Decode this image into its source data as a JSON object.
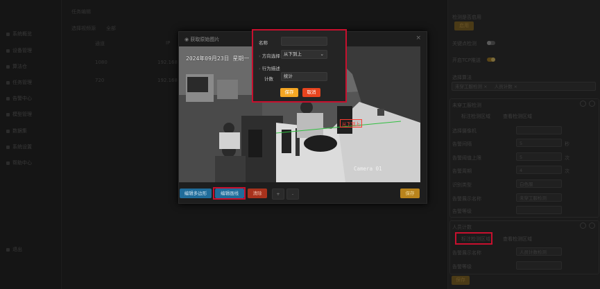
{
  "sidebar": {
    "items": [
      "系统概览",
      "设备管理",
      "算法仓",
      "任务管理",
      "告警中心",
      "模型管理",
      "数据集",
      "系统设置",
      "帮助中心",
      "退出"
    ]
  },
  "background": {
    "header": "任务编辑",
    "filter_text": "选择视频源",
    "filter_value": "全部",
    "col_a": "通道",
    "col_b": "IP",
    "row1": "1080",
    "row1_ip": "192.168",
    "row2": "720",
    "row2_ip": "192.168"
  },
  "right_panel": {
    "rule_enable_label": "检测是否启用",
    "rule_enable_btn": "启用",
    "toggle1_label": "关键点检测",
    "toggle2_label": "开启TCP推送",
    "algo_select_label": "选择算法",
    "algo_tags": [
      "未穿工服检测 ×",
      "人员计数 ×"
    ],
    "section1": {
      "title": "未穿工服检测",
      "tab1": "标注检测区域",
      "tab2": "查看检测区域",
      "fields": [
        {
          "label": "选择摄像机",
          "value": ""
        },
        {
          "label": "告警间隔",
          "value": "5",
          "unit": "秒"
        },
        {
          "label": "告警阈值上限",
          "value": "5",
          "unit": "次"
        },
        {
          "label": "告警周期",
          "value": "4",
          "unit": "次"
        },
        {
          "label": "识别类型",
          "value": "白色服"
        },
        {
          "label": "告警展示名称",
          "value": "未穿工服检测"
        },
        {
          "label": "告警等级",
          "value": ""
        }
      ]
    },
    "section2": {
      "title": "人员计数",
      "tab1": "标注检测区域",
      "tab2": "查看检测区域",
      "fields": [
        {
          "label": "告警展示名称",
          "value": "人员计数检测"
        },
        {
          "label": "告警等级",
          "value": ""
        }
      ]
    },
    "bottom_btn": "保存"
  },
  "modal": {
    "title": "获取原始图片",
    "close": "×",
    "buttons": {
      "draw_polygon": "编辑多边形",
      "draw_line": "编辑画线",
      "clear": "清除",
      "plus": "+",
      "minus": "-",
      "save": "保存"
    }
  },
  "camera": {
    "timestamp": "2024年09月23日 星期一",
    "watermark": "Camera 01",
    "line_label": "从下到上"
  },
  "popup": {
    "name_label": "名称",
    "name_value": "",
    "direction_label": "方向选择",
    "direction_value": "从下到上",
    "behavior_label": "行为描述",
    "count_label": "计数",
    "count_value": "统计",
    "save_btn": "保存",
    "cancel_btn": "取消"
  },
  "colors": {
    "accent_gold": "#f5a623",
    "danger_red": "#e8441e",
    "highlight_red": "#c8102e",
    "blue_btn": "#1f6c9a"
  }
}
